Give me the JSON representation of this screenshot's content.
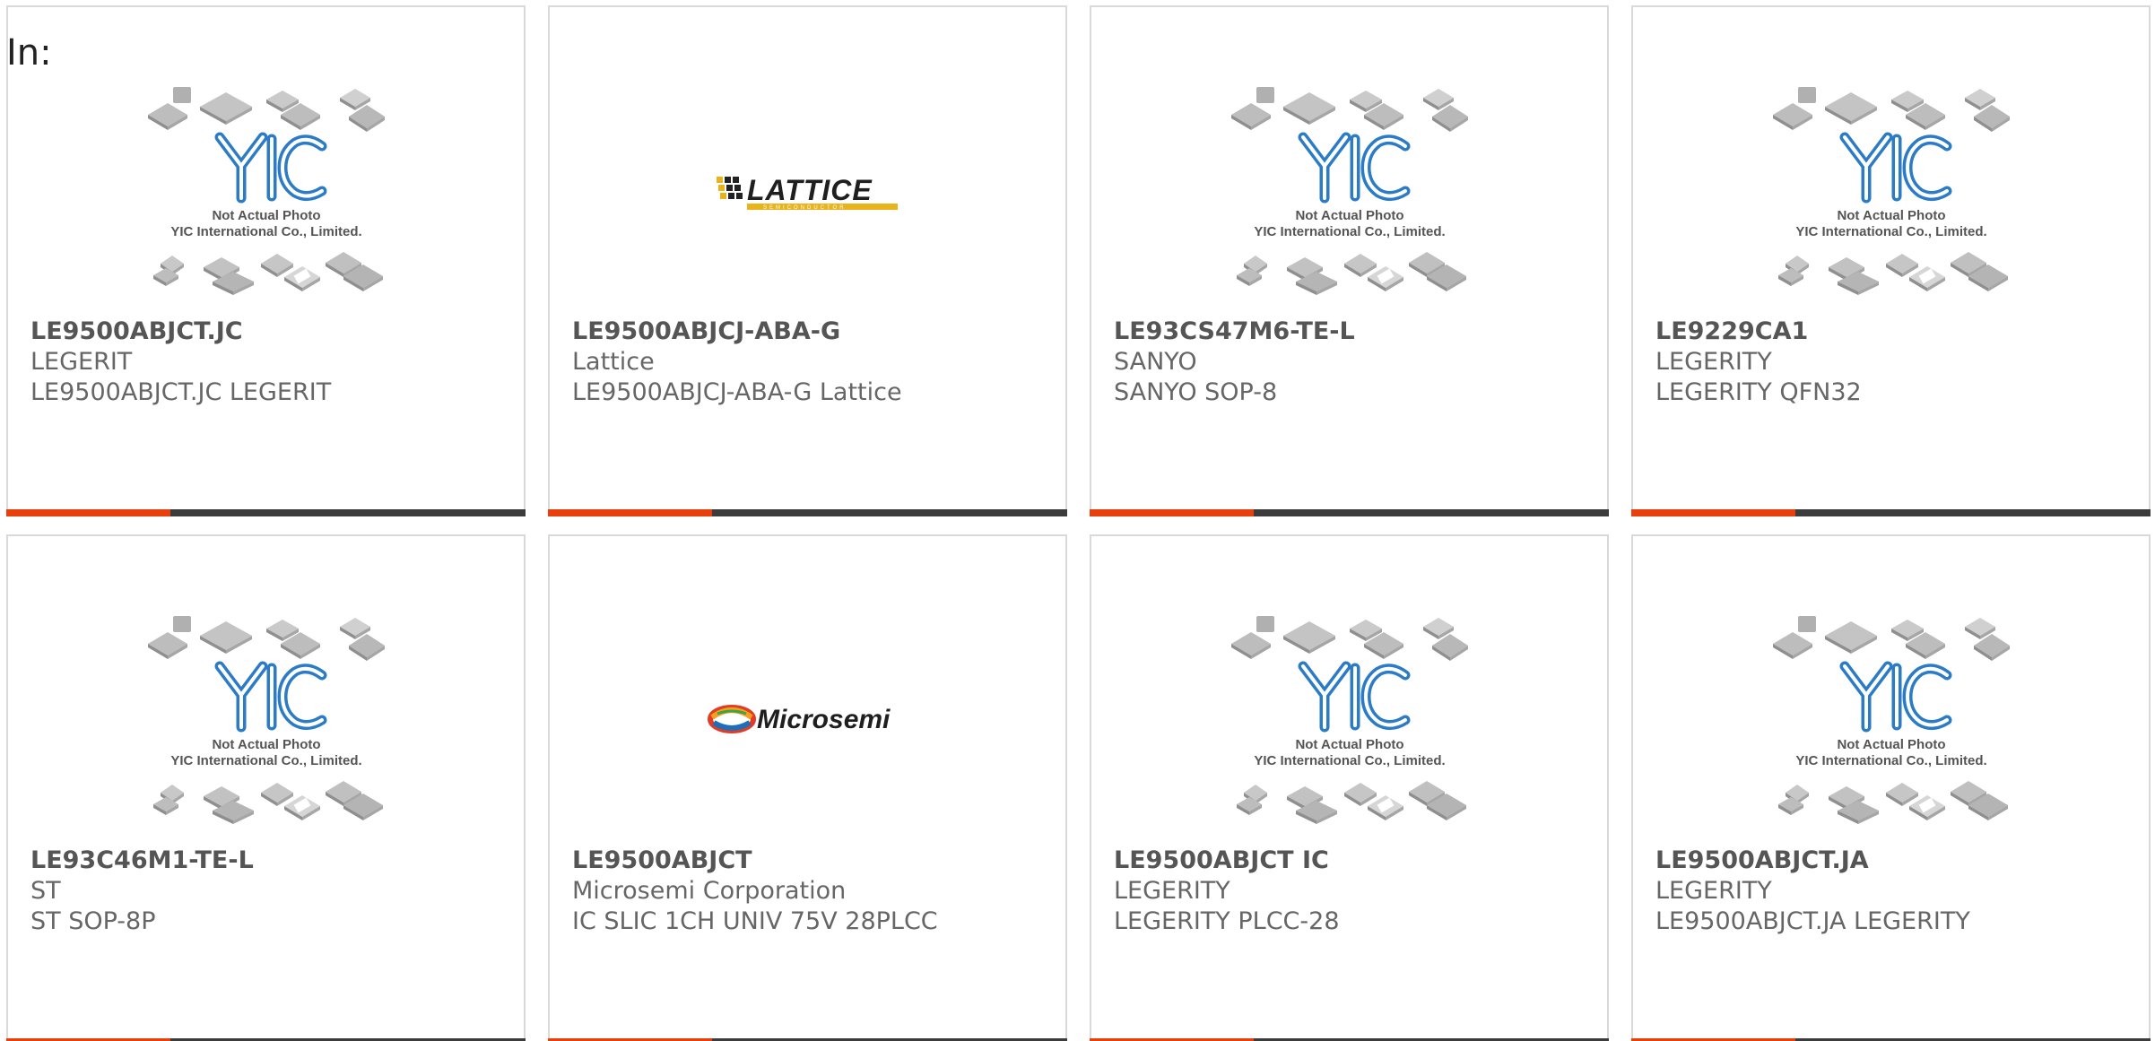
{
  "header": {
    "label": "In:"
  },
  "colors": {
    "accent": "#e8400c",
    "bar": "#3c3c3c",
    "border": "#d9d9d9",
    "text": "#555555"
  },
  "placeholder": {
    "line1": "Not Actual Photo",
    "line2": "YIC International Co., Limited.",
    "logo": "YIC"
  },
  "products": [
    {
      "part": "LE9500ABJCT.JC",
      "maker": "LEGERIT",
      "desc": "LE9500ABJCT.JC LEGERIT",
      "image": "yic-placeholder"
    },
    {
      "part": "LE9500ABJCJ-ABA-G",
      "maker": "Lattice",
      "desc": "LE9500ABJCJ-ABA-G Lattice",
      "image": "lattice-logo",
      "logo_text": "LATTICE",
      "logo_sub": "SEMICONDUCTOR"
    },
    {
      "part": "LE93CS47M6-TE-L",
      "maker": "SANYO",
      "desc": "SANYO SOP-8",
      "image": "yic-placeholder"
    },
    {
      "part": "LE9229CA1",
      "maker": "LEGERITY",
      "desc": "LEGERITY QFN32",
      "image": "yic-placeholder"
    },
    {
      "part": "LE93C46M1-TE-L",
      "maker": "ST",
      "desc": "ST SOP-8P",
      "image": "yic-placeholder"
    },
    {
      "part": "LE9500ABJCT",
      "maker": "Microsemi Corporation",
      "desc": "IC SLIC 1CH UNIV 75V 28PLCC",
      "image": "microsemi-logo",
      "logo_text": "Microsemi"
    },
    {
      "part": "LE9500ABJCT IC",
      "maker": "LEGERITY",
      "desc": "LEGERITY PLCC-28",
      "image": "yic-placeholder"
    },
    {
      "part": "LE9500ABJCT.JA",
      "maker": "LEGERITY",
      "desc": "LE9500ABJCT.JA LEGERITY",
      "image": "yic-placeholder"
    }
  ]
}
